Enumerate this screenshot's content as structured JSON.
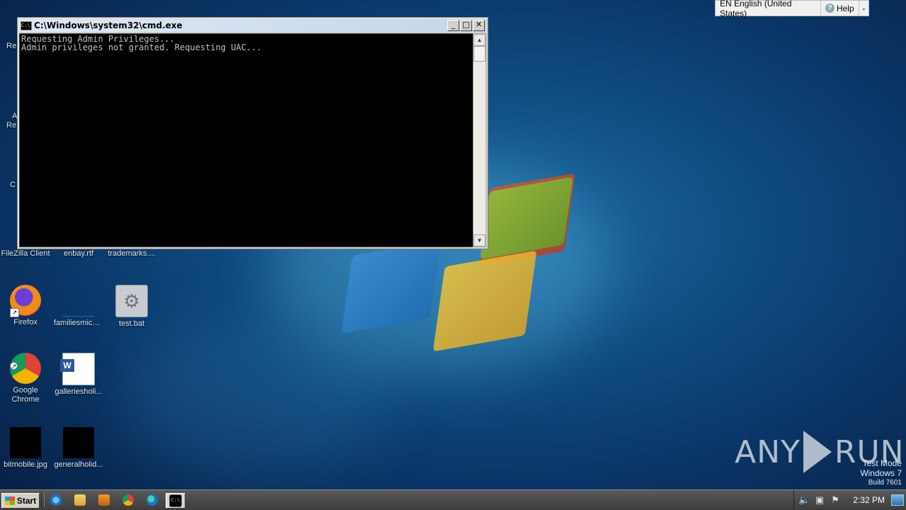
{
  "desktop": {
    "icons": [
      {
        "label": "FileZilla Client"
      },
      {
        "label": "enbay.rtf"
      },
      {
        "label": "trademarks...."
      },
      {
        "label": "Firefox"
      },
      {
        "label": "familiesmichi..."
      },
      {
        "label": "test.bat"
      },
      {
        "label": "Google Chrome"
      },
      {
        "label": "galleriesholi..."
      },
      {
        "label": "bitmobile.jpg"
      },
      {
        "label": "generalholid..."
      }
    ],
    "partial_labels": [
      "Re",
      "A",
      "Re",
      "C"
    ]
  },
  "cmd_window": {
    "title": "C:\\Windows\\system32\\cmd.exe",
    "icon_text": "C:\\",
    "minimize": "_",
    "maximize": "□",
    "close": "✕",
    "output": "Requesting Admin Privileges...\nAdmin privileges not granted. Requesting UAC...",
    "scroll_up": "▲",
    "scroll_down": "▼"
  },
  "language_bar": {
    "language": "EN English (United States)",
    "help": "Help",
    "help_icon": "?",
    "options": "⌄"
  },
  "watermark": {
    "left": "ANY",
    "right": "RUN",
    "test_mode_line1": "Test Mode",
    "test_mode_line2": "Windows 7",
    "build": "Build 7601"
  },
  "taskbar": {
    "start_label": "Start",
    "clock": "2:32 PM",
    "cmd_icon_text": "C:\\",
    "tray_icons": [
      "volume-icon",
      "network-icon",
      "action-center-flag-icon"
    ]
  }
}
